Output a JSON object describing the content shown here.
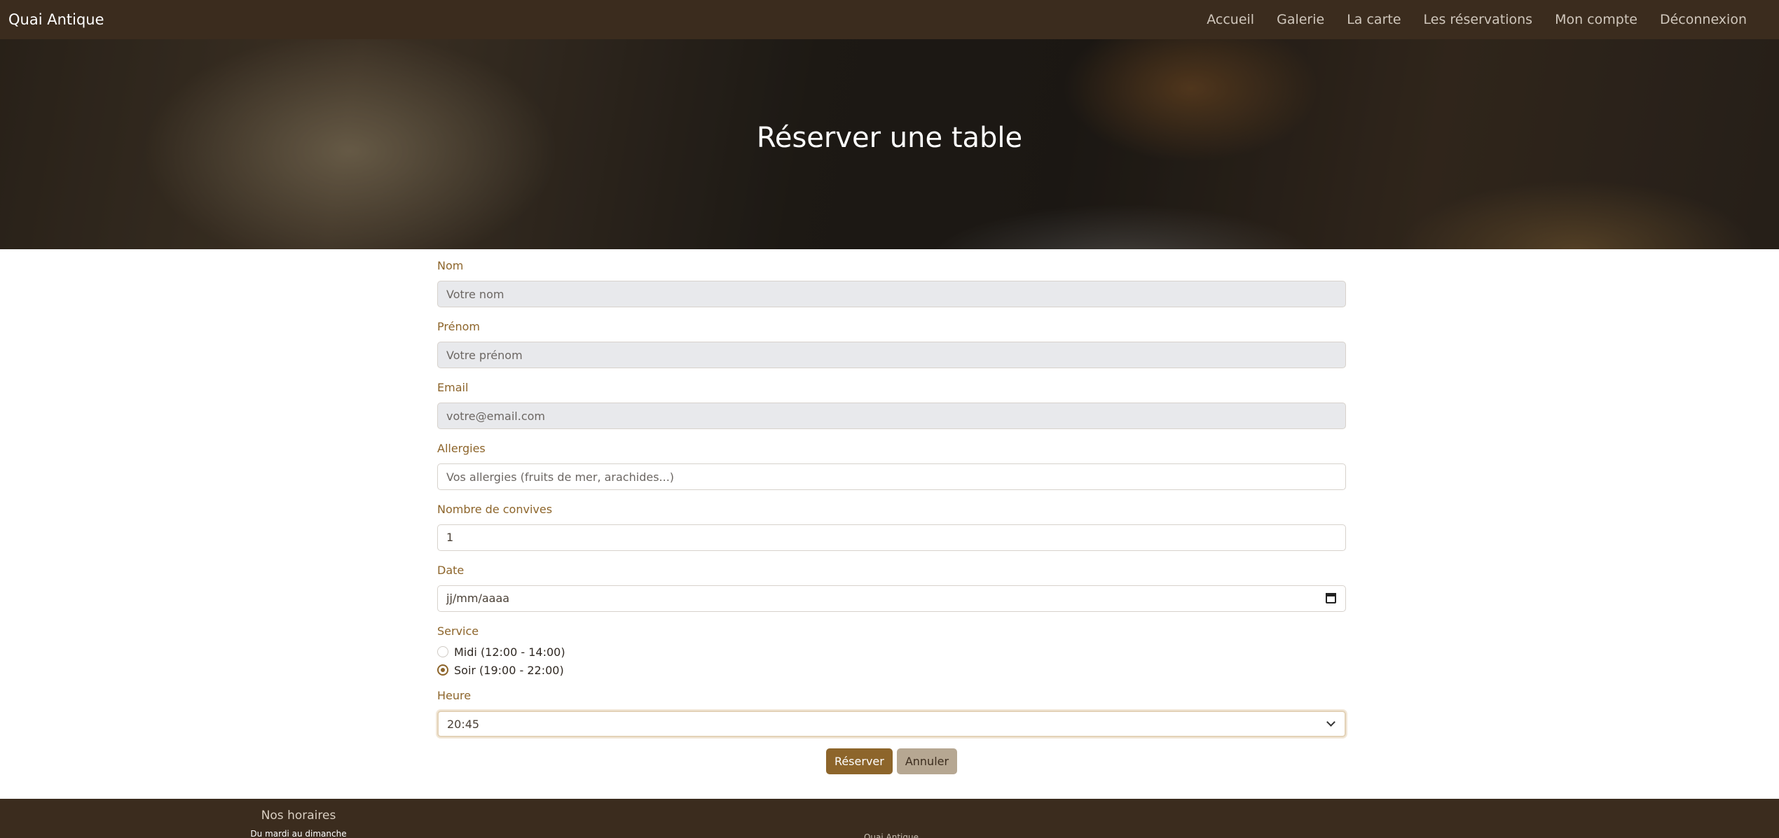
{
  "navbar": {
    "brand": "Quai Antique",
    "links": [
      "Accueil",
      "Galerie",
      "La carte",
      "Les réservations",
      "Mon compte",
      "Déconnexion"
    ]
  },
  "hero": {
    "title": "Réserver une table"
  },
  "form": {
    "nom": {
      "label": "Nom",
      "placeholder": "Votre nom"
    },
    "prenom": {
      "label": "Prénom",
      "placeholder": "Votre prénom"
    },
    "email": {
      "label": "Email",
      "placeholder": "votre@email.com"
    },
    "allergies": {
      "label": "Allergies",
      "placeholder": "Vos allergies (fruits de mer, arachides...)"
    },
    "convives": {
      "label": "Nombre de convives",
      "value": "1"
    },
    "date": {
      "label": "Date",
      "value": "jj/mm/aaaa"
    },
    "service": {
      "label": "Service",
      "options": [
        {
          "label": "Midi (12:00 - 14:00)",
          "checked": false
        },
        {
          "label": "Soir (19:00 - 22:00)",
          "checked": true
        }
      ]
    },
    "heure": {
      "label": "Heure",
      "value": "20:45"
    },
    "submit_label": "Réserver",
    "cancel_label": "Annuler"
  },
  "footer": {
    "hours_title": "Nos horaires",
    "hours_sub": "Du mardi au dimanche",
    "brand": "Quai Antique"
  },
  "colors": {
    "navbar_bg": "#3b2c1e",
    "accent": "#8d652b",
    "secondary_button": "#b6a792",
    "disabled_field": "#e8e9ec"
  }
}
